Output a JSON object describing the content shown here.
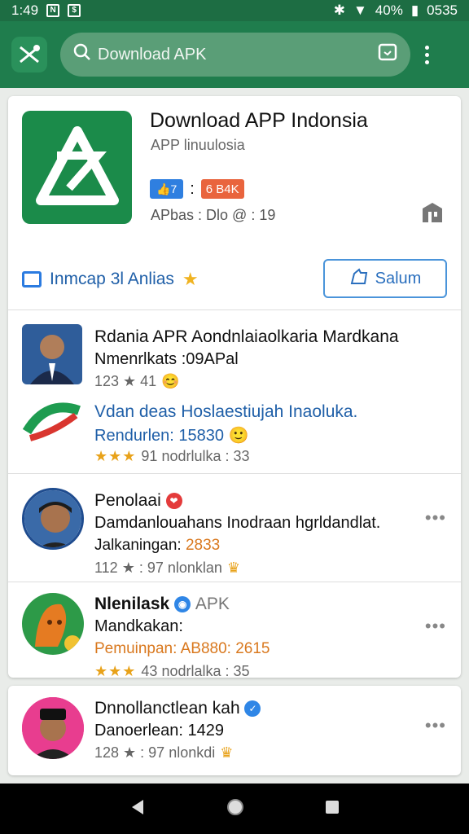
{
  "status": {
    "time": "1:49",
    "battery": "40%",
    "clock_right": "0535"
  },
  "search": {
    "placeholder": "Download APK"
  },
  "app": {
    "title": "Download APP Indonsia",
    "subtitle": "APP linuulosia",
    "badge_blue": "7",
    "badge_sep": ":",
    "badge_orange": "6 B4K",
    "meta": "APbas : Dlo @ : 19",
    "info_link": "Inmcap 3l Anlias",
    "action_button": "Salum"
  },
  "items": [
    {
      "title": "Rdania APR Aondnlaiaolkaria Mardkana",
      "line": "Nmenrlkats :09APal",
      "meta": "123 ★ 41"
    },
    {
      "title": "Vdan deas Hoslaestiujah Inaoluka.",
      "line": "Rendurlen: 15830",
      "meta_stars": "★★★",
      "meta": "91   nodrlulka : 33"
    },
    {
      "title": "Penolaai",
      "line": "Damdanlouahans Inodraan hgrldandlat.",
      "line2_label": "Jalkaningan:",
      "line2_value": "2833",
      "meta": "112 ★ : 97   nlonklan"
    },
    {
      "title": "Nlenilask",
      "title_suffix": "APK",
      "line": "Mandkakan:",
      "line2": "Pemuinpan: AB880: 2615",
      "meta_stars": "★★★",
      "meta": "43   nodrlalka : 35"
    },
    {
      "title": "Dnnollanctlean kah",
      "line": "Danoerlean: 1429",
      "meta": "128 ★ : 97   nlonkdi"
    }
  ],
  "more_label": "•••",
  "colors": {
    "brand": "#1f7d4d",
    "accent_blue": "#2f7fe0",
    "star": "#e8a21a"
  }
}
